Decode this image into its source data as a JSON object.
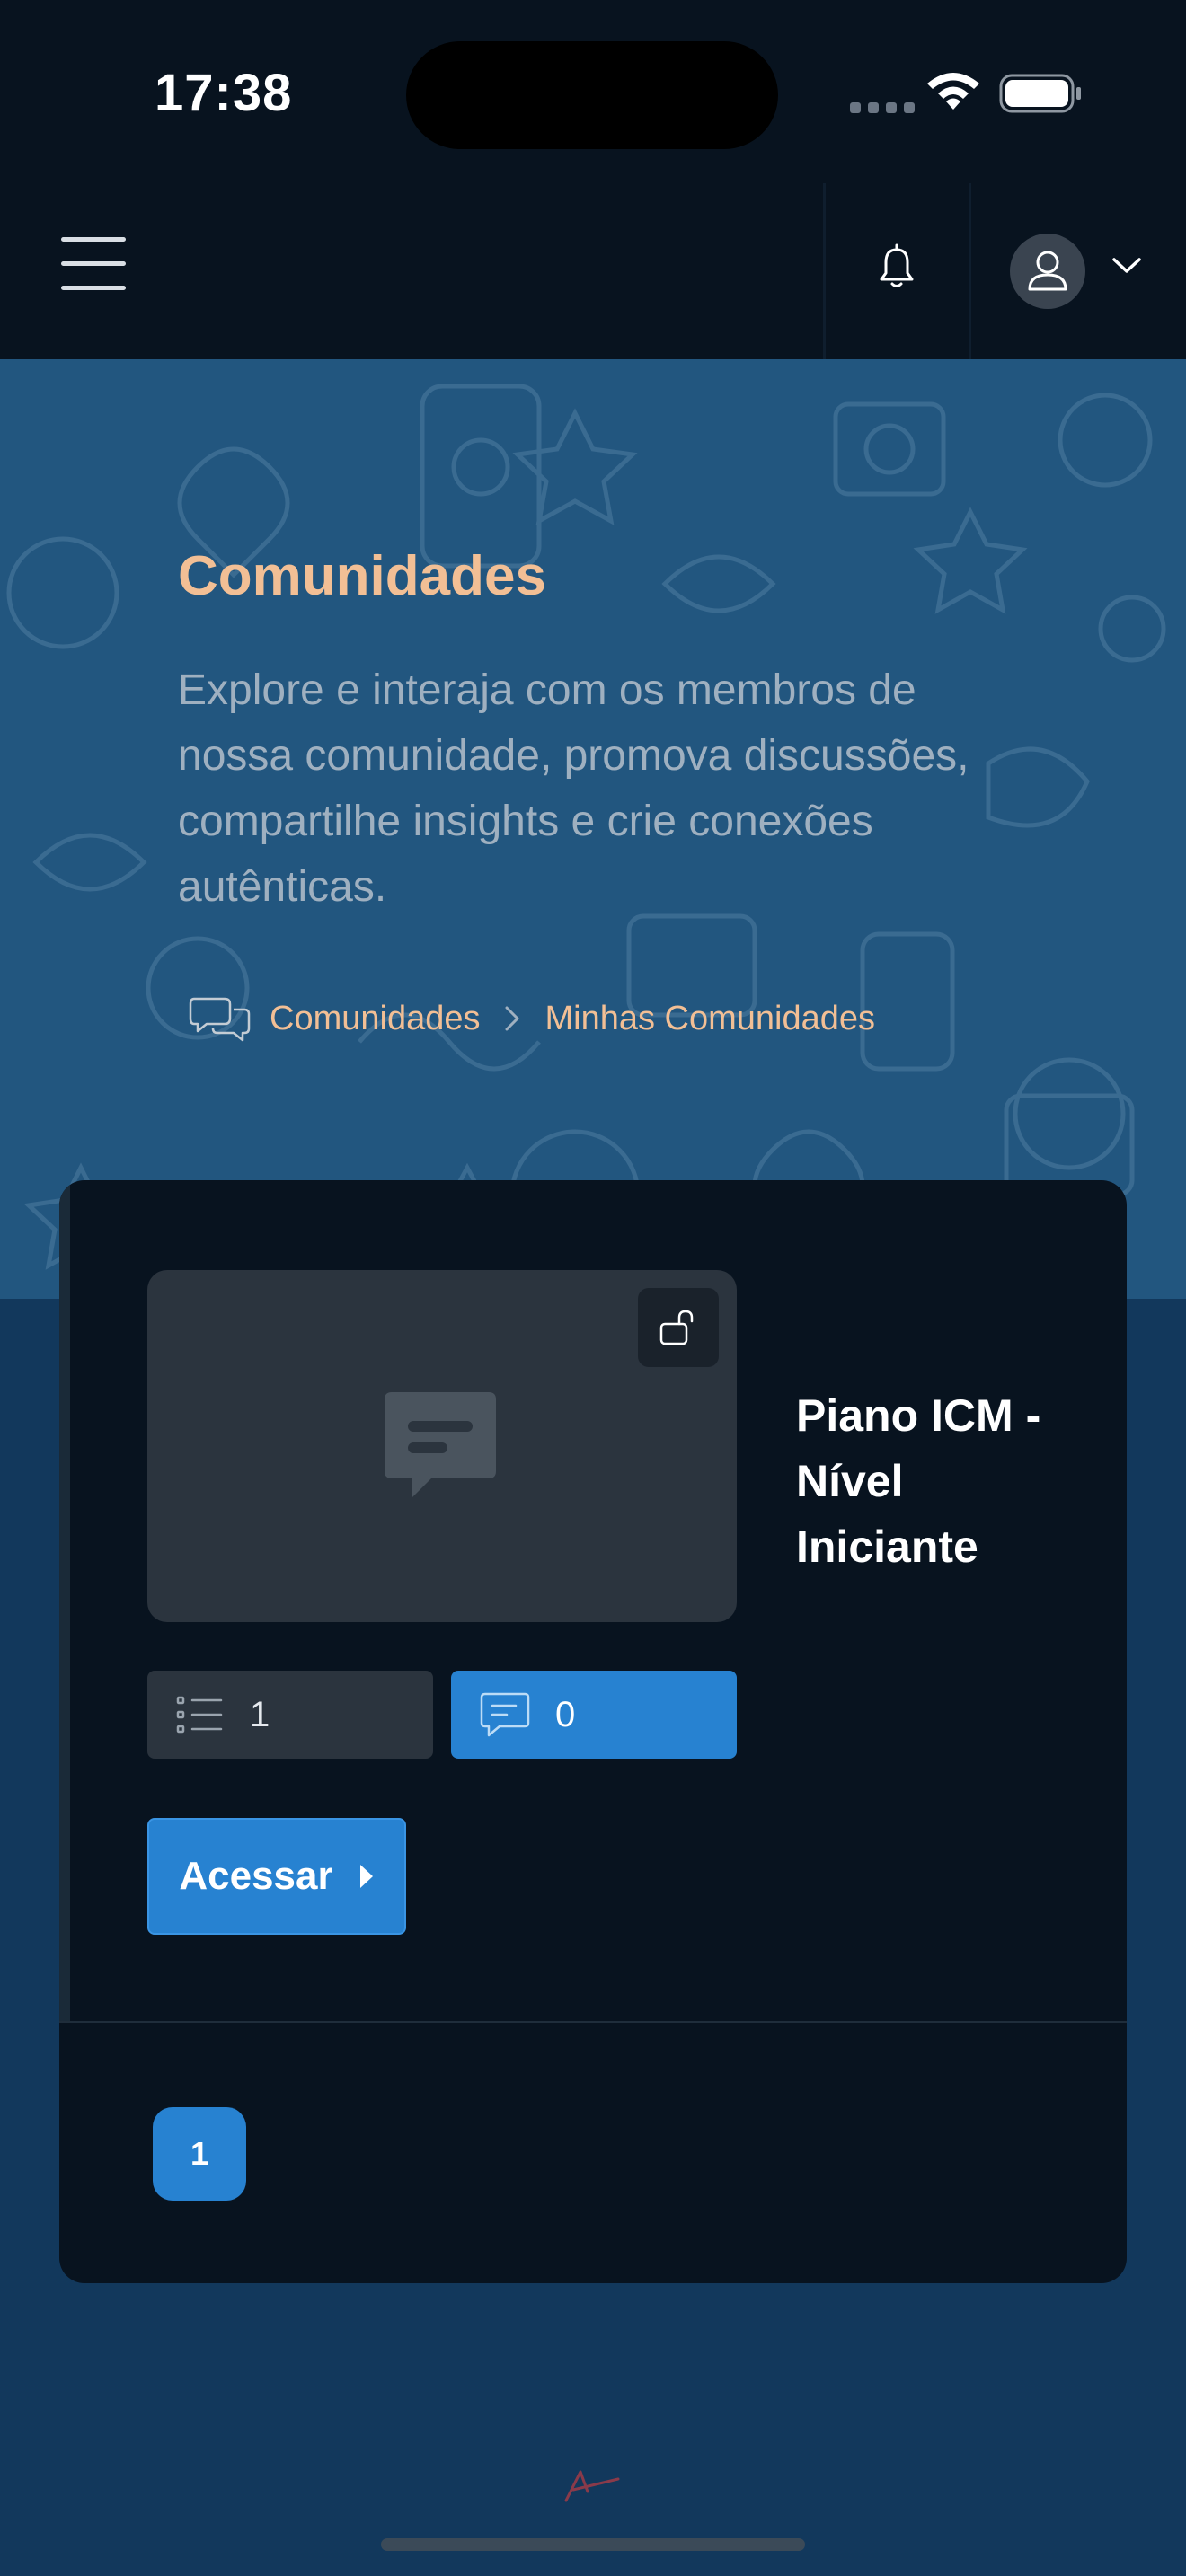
{
  "status_bar": {
    "time": "17:38"
  },
  "header": {
    "menu_icon": "hamburger-icon",
    "notification_icon": "bell-icon",
    "profile_icon": "user-icon",
    "dropdown_icon": "chevron-down-icon"
  },
  "hero": {
    "title": "Comunidades",
    "description": "Explore e interaja com os membros de nossa comunidade, promova discussões, compartilhe insights e crie conexões autênticas.",
    "breadcrumb": {
      "icon": "chat-bubbles-icon",
      "items": [
        "Comunidades",
        "Minhas Comunidades"
      ]
    }
  },
  "community_card": {
    "title": "Piano ICM - Nível Iniciante",
    "lock_icon": "unlock-icon",
    "lessons_count": "1",
    "comments_count": "0",
    "access_label": "Acessar"
  },
  "pagination": {
    "pages": [
      "1"
    ],
    "current": "1"
  },
  "colors": {
    "accent": "#2782d1",
    "title_accent": "#f2bf95",
    "header_bg": "#08131f",
    "hero_bg": "#22567f",
    "page_bg": "#12385c"
  }
}
